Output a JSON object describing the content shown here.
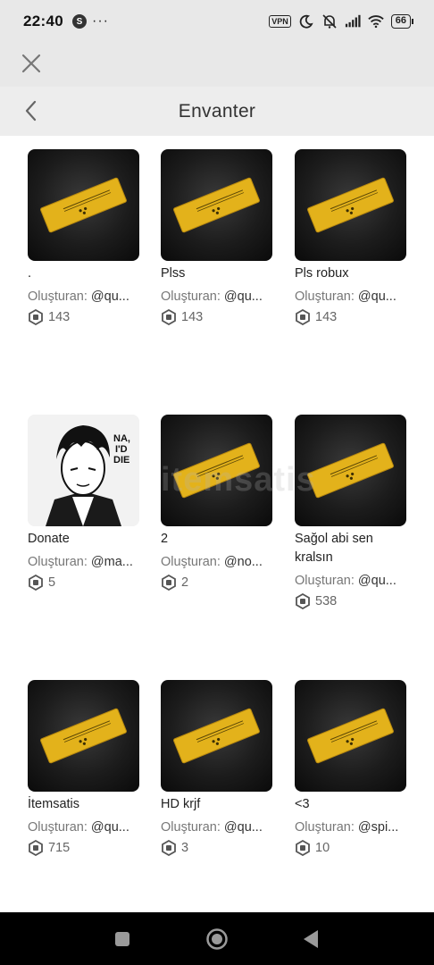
{
  "status_bar": {
    "time": "22:40",
    "notif_badge": "S",
    "more": "···",
    "vpn": "VPN",
    "battery": "66"
  },
  "header": {
    "title": "Envanter"
  },
  "creator_prefix": "Oluşturan: ",
  "items": [
    {
      "name": ".",
      "creator": "@qu...",
      "price": "143",
      "thumb": "ticket"
    },
    {
      "name": "Plss",
      "creator": "@qu...",
      "price": "143",
      "thumb": "ticket"
    },
    {
      "name": "Pls robux",
      "creator": "@qu...",
      "price": "143",
      "thumb": "ticket"
    },
    {
      "name": "Donate",
      "creator": "@ma...",
      "price": "5",
      "thumb": "avatar"
    },
    {
      "name": "2",
      "creator": "@no...",
      "price": "2",
      "thumb": "ticket"
    },
    {
      "name": "Sağol abi sen kralsın",
      "creator": "@qu...",
      "price": "538",
      "thumb": "ticket"
    },
    {
      "name": "İtemsatis",
      "creator": "@qu...",
      "price": "715",
      "thumb": "ticket"
    },
    {
      "name": "HD krjf",
      "creator": "@qu...",
      "price": "3",
      "thumb": "ticket"
    },
    {
      "name": "<3",
      "creator": "@spi...",
      "price": "10",
      "thumb": "ticket"
    }
  ],
  "watermark": "itemsatis",
  "colors": {
    "ticket_gold": "#e3b21b",
    "header_bg": "#ededed",
    "topbar_bg": "#e8e8e8"
  }
}
